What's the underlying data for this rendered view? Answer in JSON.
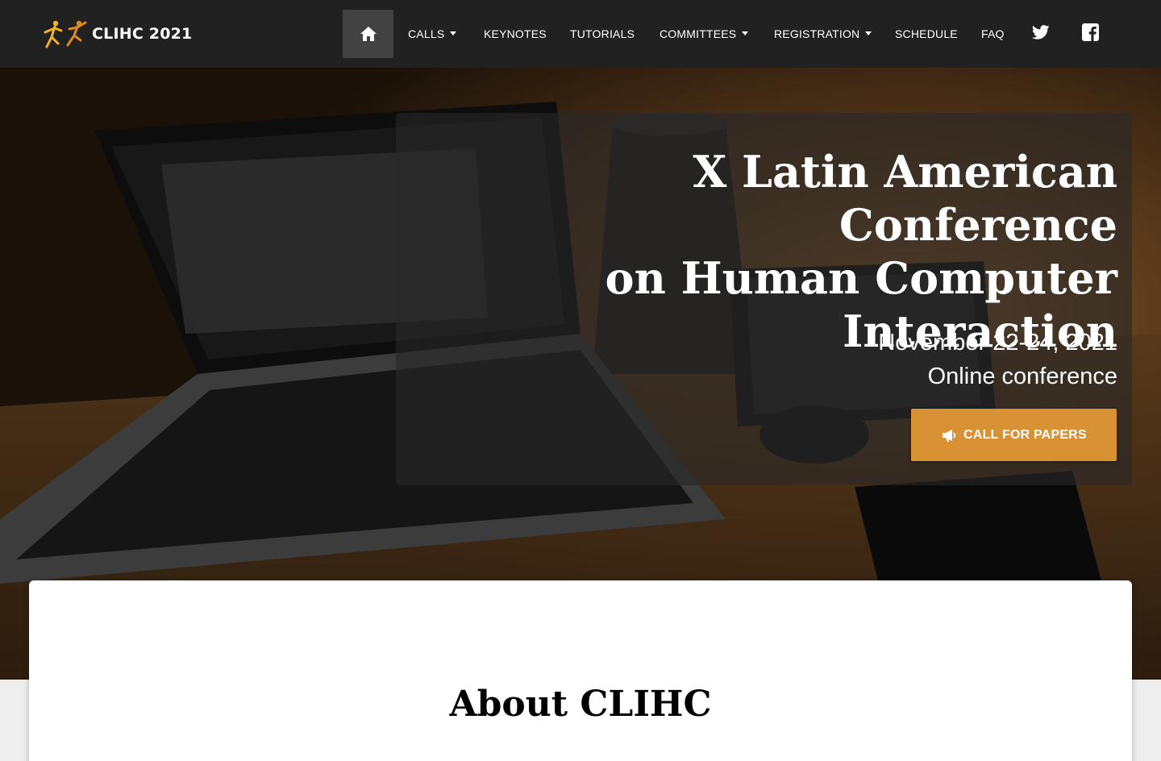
{
  "brand": {
    "name": "CLIHC 2021",
    "logo_icon": "clihc-figures-logo",
    "logo_colors": [
      "#f3b22a",
      "#e08a1e"
    ]
  },
  "nav": {
    "home_icon": "home-icon",
    "items": [
      {
        "label": "CALLS",
        "dropdown": true
      },
      {
        "label": "KEYNOTES",
        "dropdown": false
      },
      {
        "label": "TUTORIALS",
        "dropdown": false
      },
      {
        "label": "COMMITTEES",
        "dropdown": true
      },
      {
        "label": "REGISTRATION",
        "dropdown": true
      },
      {
        "label": "SCHEDULE",
        "dropdown": false
      },
      {
        "label": "FAQ",
        "dropdown": false
      }
    ],
    "social": [
      "twitter-icon",
      "facebook-icon"
    ]
  },
  "hero": {
    "title_lines": [
      "X Latin American Conference",
      "on Human Computer",
      "Interaction"
    ],
    "date": "November 22-24, 2021",
    "format": "Online conference",
    "cta_label": "CALL FOR PAPERS",
    "cta_icon": "megaphone-icon",
    "cta_color": "#d89234"
  },
  "about": {
    "title": "About CLIHC"
  },
  "colors": {
    "navbar_bg": "#212121",
    "nav_active_bg": "#424242",
    "page_bg": "#eeeeee"
  }
}
